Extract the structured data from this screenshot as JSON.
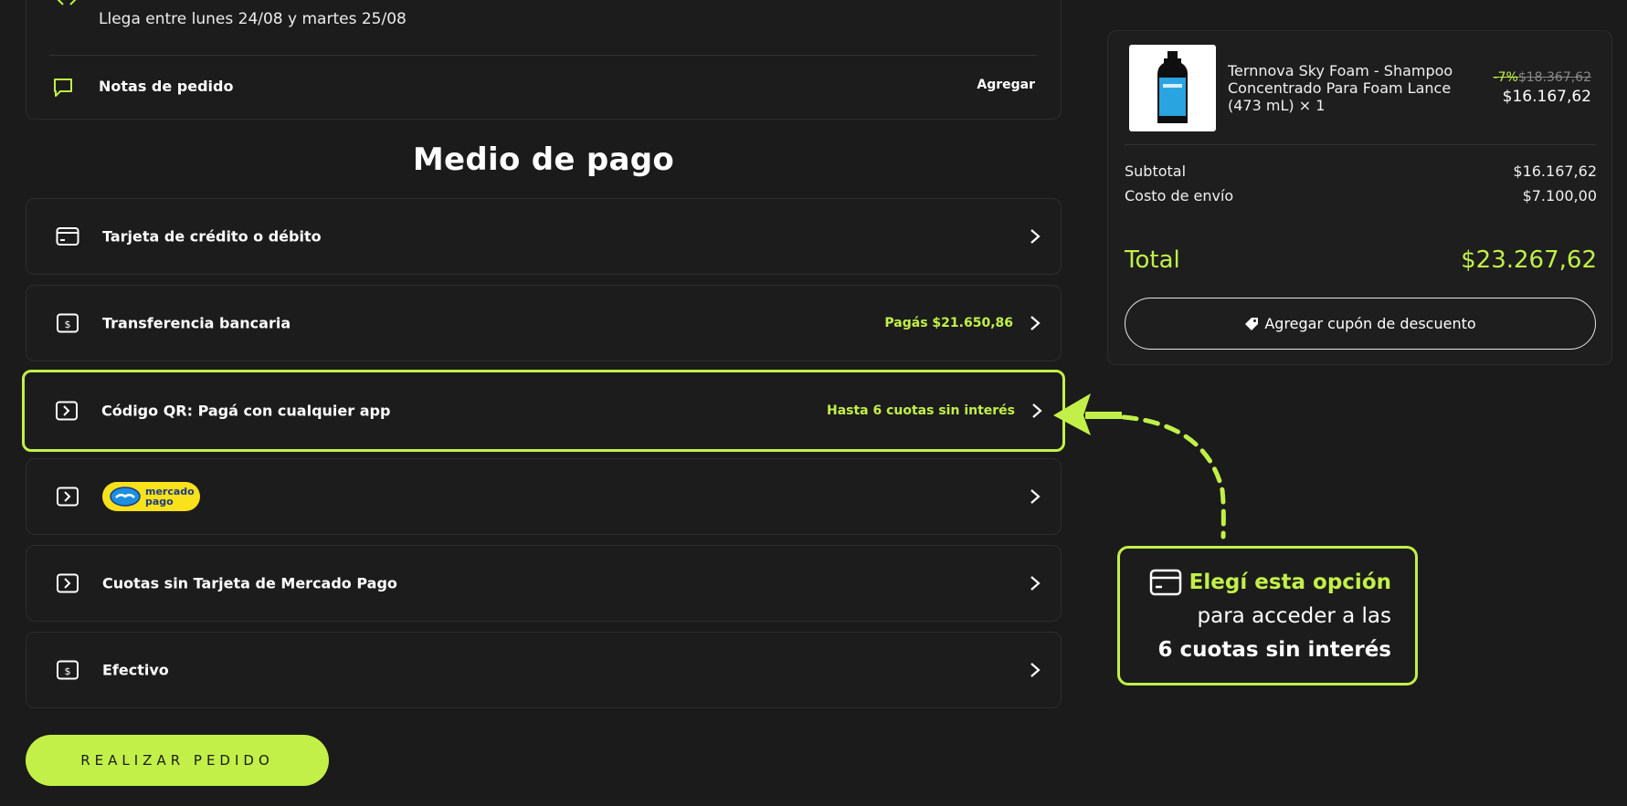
{
  "shipping": {
    "arrival_text": "Llega entre lunes 24/08 y martes 25/08"
  },
  "order_notes": {
    "label": "Notas de pedido",
    "action": "Agregar"
  },
  "payment": {
    "title": "Medio de pago",
    "methods": [
      {
        "label": "Tarjeta de crédito o débito",
        "note": "",
        "icon": "credit-card-icon"
      },
      {
        "label": "Transferencia bancaria",
        "note": "Pagás $21.650,86",
        "icon": "bank-transfer-icon"
      },
      {
        "label": "Código QR: Pagá con cualquier app",
        "note": "Hasta 6 cuotas sin interés",
        "icon": "qr-redirect-icon",
        "selected": true
      },
      {
        "label": "",
        "note": "",
        "icon": "redirect-icon",
        "badge": "mercado pago"
      },
      {
        "label": "Cuotas sin Tarjeta de Mercado Pago",
        "note": "",
        "icon": "redirect-icon"
      },
      {
        "label": "Efectivo",
        "note": "",
        "icon": "cash-icon"
      }
    ],
    "mercadopago_badge": {
      "line1": "mercado",
      "line2": "pago"
    },
    "place_order": "REALIZAR PEDIDO"
  },
  "summary": {
    "product": {
      "name": "Ternnova Sky Foam - Shampoo Concentrado Para Foam Lance (473 mL) × 1",
      "old_price_prefix": "-7%",
      "old_price": "$18.367,62",
      "price": "$16.167,62"
    },
    "subtotal_label": "Subtotal",
    "subtotal_value": "$16.167,62",
    "shipping_label": "Costo de envío",
    "shipping_value": "$7.100,00",
    "total_label": "Total",
    "total_value": "$23.267,62",
    "coupon_label": "Agregar cupón de descuento"
  },
  "callout": {
    "line1": "Elegí esta opción",
    "line2": "para acceder a las",
    "line3": "6 cuotas sin interés"
  },
  "colors": {
    "accent": "#c2f048",
    "background": "#1b1b1b",
    "mercadopago_yellow": "#f9e11c"
  }
}
